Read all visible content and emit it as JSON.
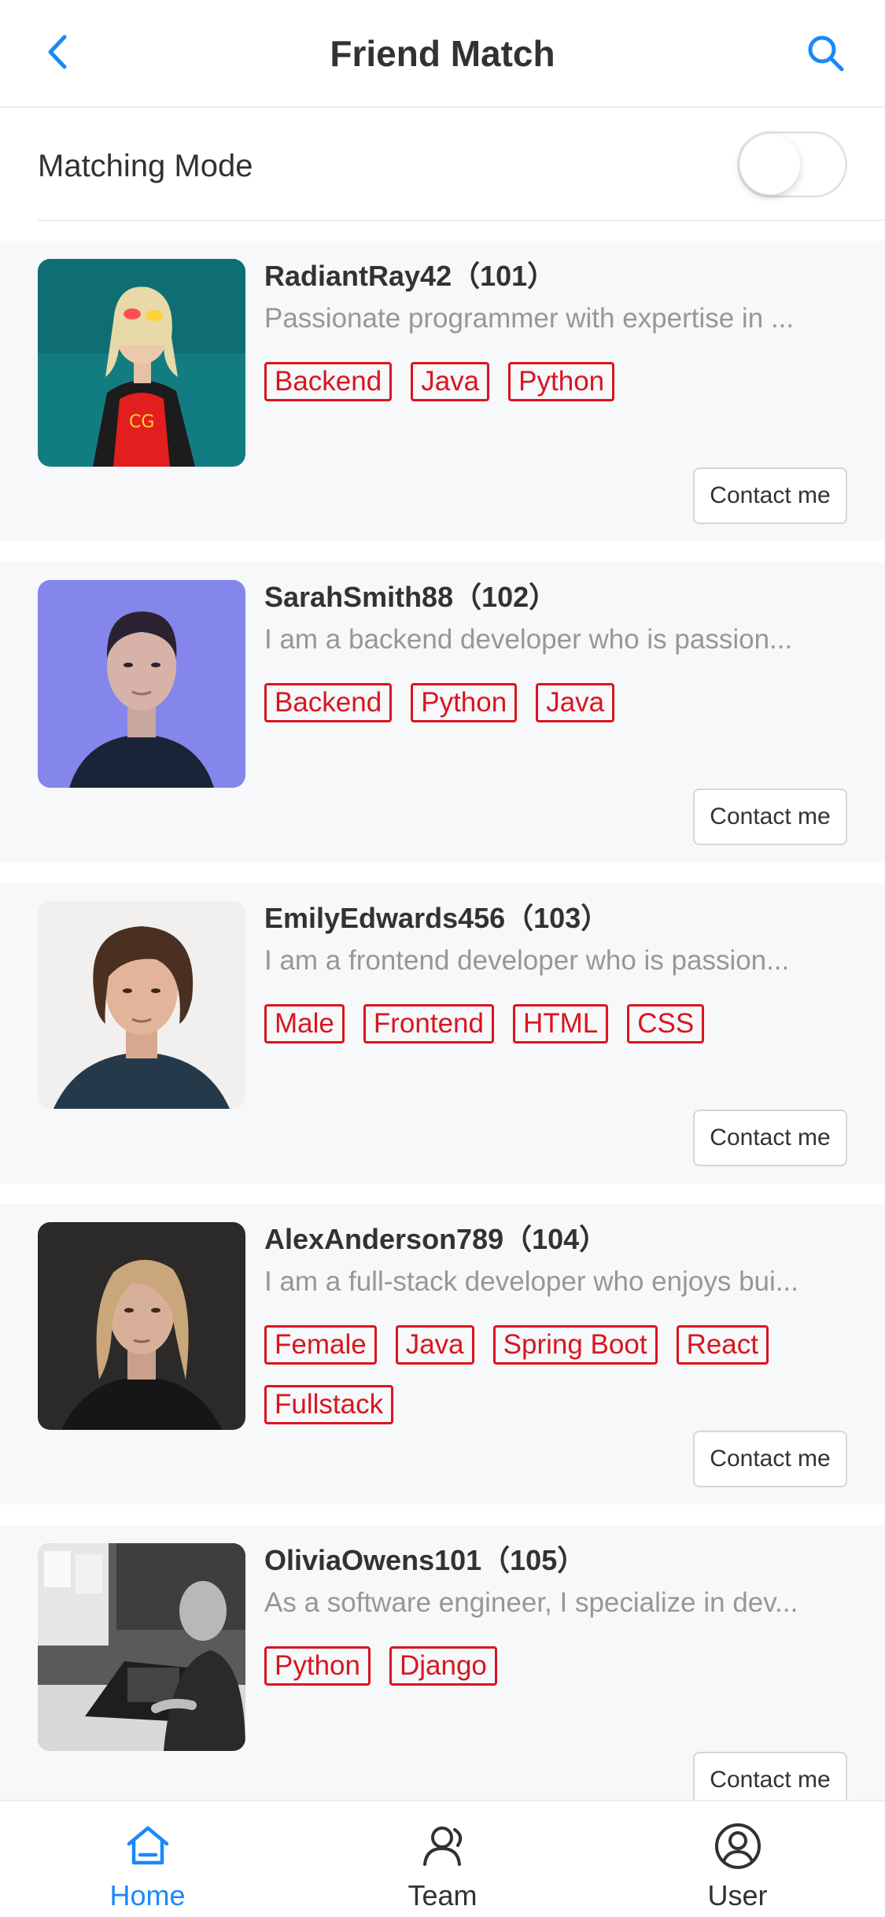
{
  "nav": {
    "title": "Friend Match",
    "back_icon": "chevron-left-icon",
    "search_icon": "search-icon"
  },
  "matching": {
    "label": "Matching Mode",
    "enabled": false
  },
  "colors": {
    "accent": "#1989fa",
    "tag": "#d9151f",
    "card_bg": "#f7f8fa",
    "desc": "#969799"
  },
  "users": [
    {
      "title": "RadiantRay42（101）",
      "desc": "Passionate programmer with expertise in ...",
      "tags": [
        "Backend",
        "Java",
        "Python"
      ],
      "contact": "Contact me",
      "avatar": "person-red-shirt-photo"
    },
    {
      "title": "SarahSmith88（102）",
      "desc": "I am a backend developer who is passion...",
      "tags": [
        "Backend",
        "Python",
        "Java"
      ],
      "contact": "Contact me",
      "avatar": "person-blue-light-photo"
    },
    {
      "title": "EmilyEdwards456（103）",
      "desc": "I am a frontend developer who is passion...",
      "tags": [
        "Male",
        "Frontend",
        "HTML",
        "CSS"
      ],
      "contact": "Contact me",
      "avatar": "young-man-portrait-photo"
    },
    {
      "title": "AlexAnderson789（104）",
      "desc": "I am a full-stack developer who enjoys bui...",
      "tags": [
        "Female",
        "Java",
        "Spring Boot",
        "React",
        "Fullstack"
      ],
      "contact": "Contact me",
      "avatar": "woman-dark-portrait-photo"
    },
    {
      "title": "OliviaOwens101（105）",
      "desc": "As a software engineer, I specialize in dev...",
      "tags": [
        "Python",
        "Django"
      ],
      "contact": "Contact me",
      "avatar": "person-at-laptop-photo"
    }
  ],
  "tabbar": {
    "items": [
      {
        "label": "Home",
        "icon": "home-icon",
        "active": true
      },
      {
        "label": "Team",
        "icon": "team-icon",
        "active": false
      },
      {
        "label": "User",
        "icon": "user-icon",
        "active": false
      }
    ]
  }
}
